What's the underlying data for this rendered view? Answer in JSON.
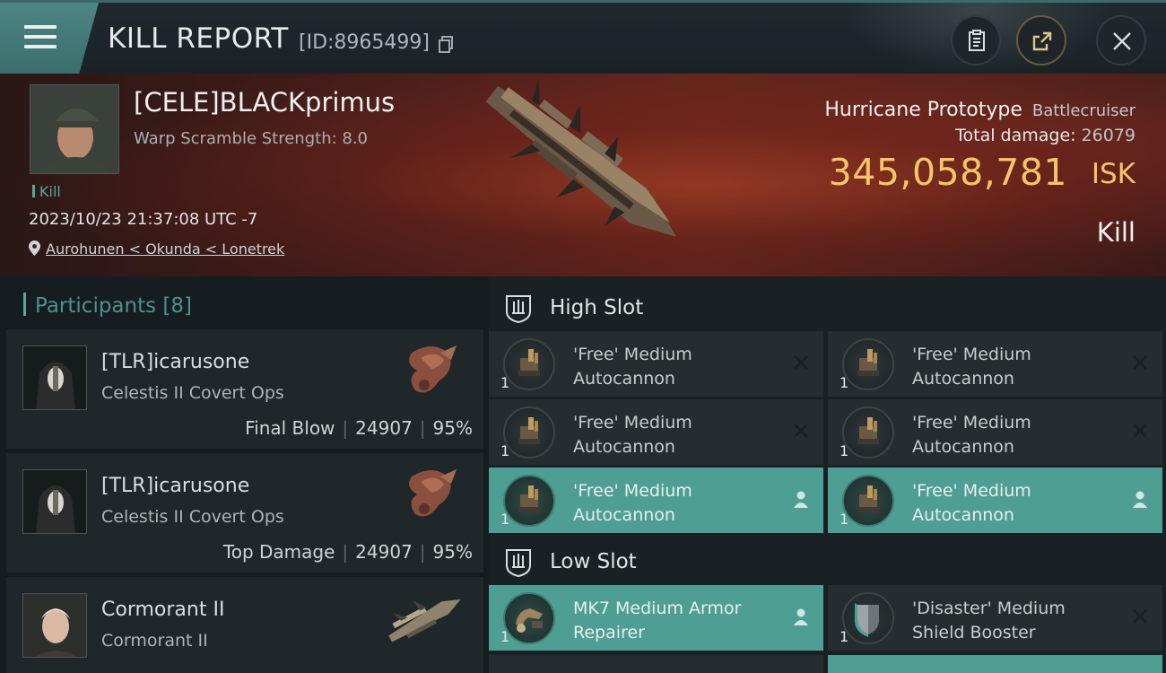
{
  "header": {
    "title": "KILL REPORT",
    "report_id": "[ID:8965499]",
    "icons": [
      "menu-icon",
      "copy-icon",
      "clipboard-icon",
      "share-icon",
      "close-icon"
    ]
  },
  "victim": {
    "pilot_name": "[CELE]BLACKprimus",
    "scramble_text": "Warp Scramble Strength: 8.0",
    "kill_tag": "Kill",
    "timestamp": "2023/10/23 21:37:08 UTC -7",
    "location": "Aurohunen < Okunda < Lonetrek",
    "ship_name": "Hurricane Prototype",
    "ship_class": "Battlecruiser",
    "total_damage_label": "Total damage:",
    "total_damage_value": "26079",
    "isk_value": "345,058,781",
    "isk_label": "ISK",
    "result_label": "Kill"
  },
  "participants": {
    "label": "Participants",
    "count": "[8]",
    "rows": [
      {
        "name": "[TLR]icarusone",
        "ship": "Celestis II Covert Ops",
        "tag": "Final Blow",
        "damage": "24907",
        "percent": "95%"
      },
      {
        "name": "[TLR]icarusone",
        "ship": "Celestis II Covert Ops",
        "tag": "Top Damage",
        "damage": "24907",
        "percent": "95%"
      },
      {
        "name": "Cormorant II",
        "ship": "Cormorant II",
        "tag": "",
        "damage": "",
        "percent": ""
      }
    ]
  },
  "fitting": {
    "high_slot_label": "High Slot",
    "low_slot_label": "Low Slot",
    "high_slots": [
      {
        "line1": "'Free' Medium",
        "line2": "Autocannon",
        "qty": "1",
        "state": "destroyed"
      },
      {
        "line1": "'Free' Medium",
        "line2": "Autocannon",
        "qty": "1",
        "state": "destroyed"
      },
      {
        "line1": "'Free' Medium",
        "line2": "Autocannon",
        "qty": "1",
        "state": "destroyed"
      },
      {
        "line1": "'Free' Medium",
        "line2": "Autocannon",
        "qty": "1",
        "state": "destroyed"
      },
      {
        "line1": "'Free' Medium",
        "line2": "Autocannon",
        "qty": "1",
        "state": "dropped"
      },
      {
        "line1": "'Free' Medium",
        "line2": "Autocannon",
        "qty": "1",
        "state": "dropped"
      }
    ],
    "low_slots": [
      {
        "line1": "MK7 Medium Armor",
        "line2": "Repairer",
        "qty": "1",
        "state": "dropped"
      },
      {
        "line1": "'Disaster' Medium",
        "line2": "Shield Booster",
        "qty": "1",
        "state": "destroyed"
      }
    ]
  },
  "colors": {
    "accent_teal": "#4f9e93",
    "isk_gold": "#f3c767",
    "banner_red": "#5a231c"
  }
}
